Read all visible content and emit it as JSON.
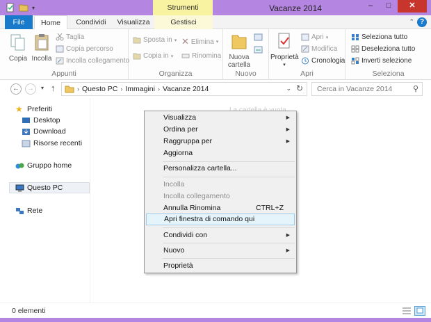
{
  "window": {
    "title": "Vacanze 2014",
    "context_tab_header": "Strumenti immagini",
    "minimize": "–",
    "maximize": "□",
    "close": "✕"
  },
  "tabs": {
    "file": "File",
    "home": "Home",
    "share": "Condividi",
    "view": "Visualizza",
    "manage": "Gestisci"
  },
  "ribbon": {
    "appunti": {
      "label": "Appunti",
      "copy": "Copia",
      "paste": "Incolla",
      "cut": "Taglia",
      "copy_path": "Copia percorso",
      "paste_shortcut": "Incolla collegamento"
    },
    "organizza": {
      "label": "Organizza",
      "move_to": "Sposta in",
      "copy_to": "Copia in",
      "delete": "Elimina",
      "rename": "Rinomina"
    },
    "nuovo": {
      "label": "Nuovo",
      "new_folder_1": "Nuova",
      "new_folder_2": "cartella"
    },
    "apri": {
      "label": "Apri",
      "properties": "Proprietà",
      "open": "Apri",
      "edit": "Modifica",
      "history": "Cronologia"
    },
    "seleziona": {
      "label": "Seleziona",
      "select_all": "Seleziona tutto",
      "select_none": "Deseleziona tutto",
      "invert": "Inverti selezione"
    }
  },
  "address": {
    "crumbs": [
      "Questo PC",
      "Immagini",
      "Vacanze 2014"
    ],
    "search_placeholder": "Cerca in Vacanze 2014"
  },
  "nav": {
    "favorites": "Preferiti",
    "desktop": "Desktop",
    "download": "Download",
    "recent": "Risorse recenti",
    "homegroup": "Gruppo home",
    "this_pc": "Questo PC",
    "network": "Rete"
  },
  "background_text": "La cartella è vuota.",
  "status": {
    "count": "0 elementi"
  },
  "context_menu": {
    "view": "Visualizza",
    "sort_by": "Ordina per",
    "group_by": "Raggruppa per",
    "refresh": "Aggiorna",
    "customize": "Personalizza cartella...",
    "paste": "Incolla",
    "paste_shortcut": "Incolla collegamento",
    "undo_rename": "Annulla Rinomina",
    "undo_shortcut": "CTRL+Z",
    "open_cmd": "Apri finestra di comando qui",
    "share_with": "Condividi con",
    "new": "Nuovo",
    "properties": "Proprietà"
  }
}
